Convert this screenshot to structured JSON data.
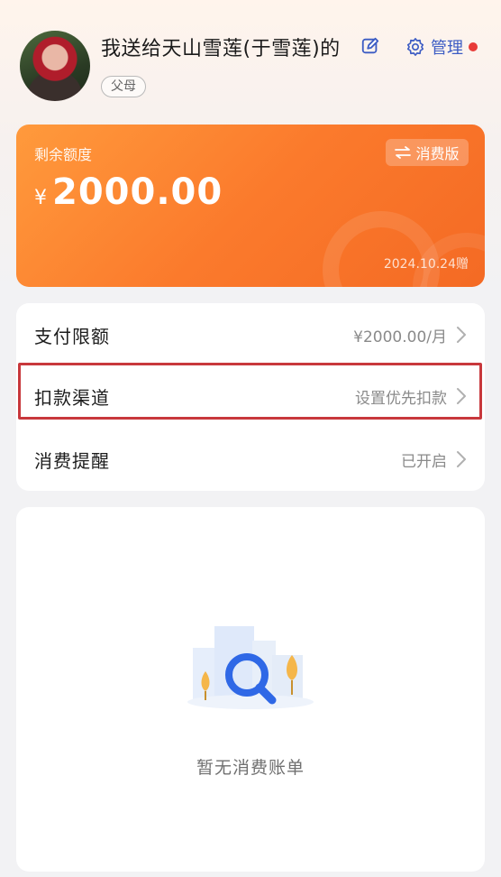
{
  "header": {
    "title": "我送给天山雪莲(于雪莲)的",
    "role_badge": "父母",
    "manage_label": "管理"
  },
  "card": {
    "label": "剩余额度",
    "currency": "¥",
    "amount": "2000.00",
    "version_label": "消费版",
    "date_note": "2024.10.24赠"
  },
  "settings": {
    "rows": [
      {
        "label": "支付限额",
        "value": "¥2000.00/月"
      },
      {
        "label": "扣款渠道",
        "value": "设置优先扣款"
      },
      {
        "label": "消费提醒",
        "value": "已开启"
      }
    ]
  },
  "bills": {
    "empty_text": "暂无消费账单"
  },
  "colors": {
    "accent_orange": "#fb7a2c",
    "link_blue": "#3c5cc4",
    "notify_red": "#e83b38",
    "highlight_red": "#c8383c"
  },
  "icons": [
    "edit-icon",
    "gear-icon",
    "swap-icon",
    "chevron-right-icon",
    "search-magnifier-icon"
  ]
}
